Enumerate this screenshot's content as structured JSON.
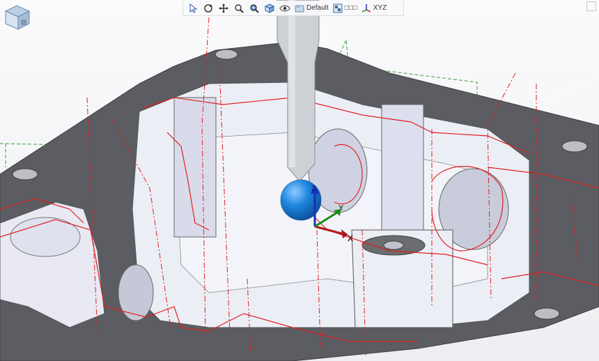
{
  "toolbar": {
    "buttons": [
      {
        "icon": "select-cursor-icon"
      },
      {
        "icon": "rotate-icon"
      },
      {
        "icon": "pan-icon"
      },
      {
        "icon": "zoom-icon"
      },
      {
        "icon": "zoom-fit-icon"
      },
      {
        "icon": "view-cube-icon"
      },
      {
        "icon": "visibility-eye-icon"
      }
    ],
    "display_mode_label": "Default",
    "layer_label": "□□□",
    "csys_label": "XYZ"
  },
  "triad": {
    "x_label": "X",
    "y_label": "Y",
    "z_label": "Z"
  },
  "colors": {
    "part_top": "#5f6166",
    "part_wall": "#e6e8f2",
    "toolpath": "#e02020",
    "probe_tip": "#1f86e0",
    "probe_shank": "#cfd1d4",
    "axis_x": "#b01818",
    "axis_y": "#1a8a1a",
    "axis_z": "#1a2ec0"
  }
}
